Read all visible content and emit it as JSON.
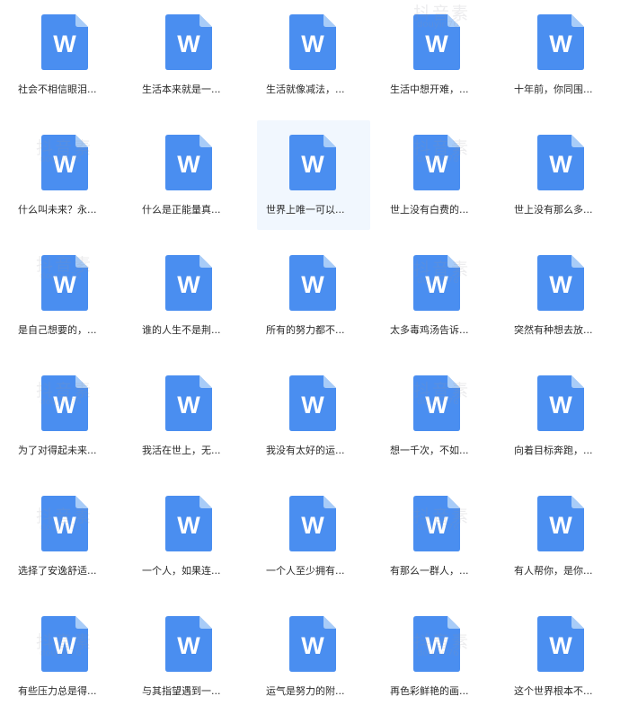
{
  "icon": {
    "name": "word-document-icon",
    "letter": "W",
    "color": "#4a8ef0",
    "fold_color": "#a8ccf8"
  },
  "watermark": {
    "main": "抖音素",
    "sub": "douyin76"
  },
  "files": [
    "社会不相信眼泪...",
    "生活本来就是一...",
    "生活就像减法，...",
    "生活中想开难，...",
    "十年前，你同围...",
    "什么叫未来？永...",
    "什么是正能量真...",
    "世界上唯一可以...",
    "世上没有白费的...",
    "世上没有那么多...",
    "是自己想要的，...",
    "谁的人生不是荆...",
    "所有的努力都不...",
    "太多毒鸡汤告诉...",
    "突然有种想去放...",
    "为了对得起未来...",
    "我活在世上，无...",
    "我没有太好的运...",
    "想一千次，不如...",
    "向着目标奔跑，...",
    "选择了安逸舒适...",
    "一个人，如果连...",
    "一个人至少拥有...",
    "有那么一群人，...",
    "有人帮你，是你...",
    "有些压力总是得...",
    "与其指望遇到一...",
    "运气是努力的附...",
    "再色彩鲜艳的画...",
    "这个世界根本不..."
  ],
  "selected_index": 7
}
